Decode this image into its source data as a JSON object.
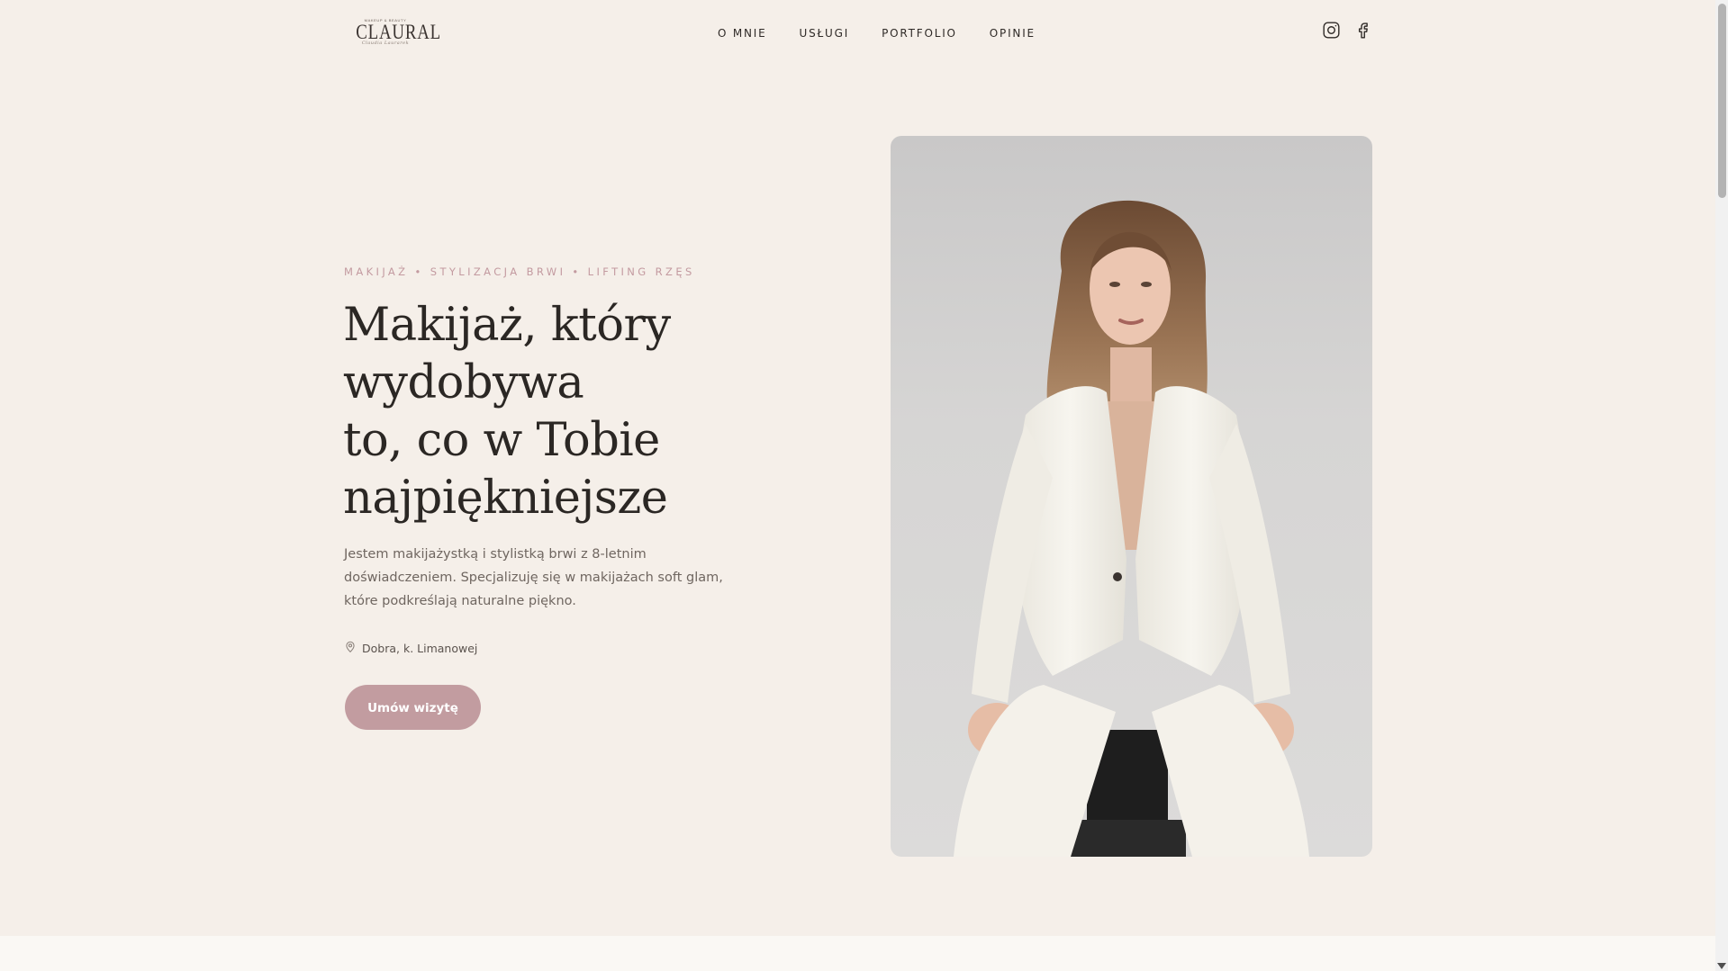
{
  "logo": {
    "top_text": "MAKEUP & BEAUTY",
    "main_text": "CLAURAL",
    "sub_text": "Claudia Laurarek"
  },
  "nav": {
    "items": [
      {
        "label": "O MNIE"
      },
      {
        "label": "USŁUGI"
      },
      {
        "label": "PORTFOLIO"
      },
      {
        "label": "OPINIE"
      }
    ]
  },
  "social": {
    "icons": [
      "instagram-icon",
      "facebook-icon"
    ]
  },
  "hero": {
    "tagline": "MAKIJAŻ • STYLIZACJA BRWI • LIFTING RZĘS",
    "headline": {
      "line1": "Makijaż, który",
      "line2": "wydobywa",
      "line3": "to, co w Tobie",
      "line4": "najpiękniejsze"
    },
    "description": "Jestem makijażystką i stylistką brwi z 8-letnim doświadczeniem. Specjalizuję się w makijażach soft glam, które podkreślają naturalne piękno.",
    "location": "Dobra, k. Limanowej",
    "cta_label": "Umów wizytę",
    "photo_alt": "Portrait of a woman in a cream suit sitting on a stool"
  },
  "colors": {
    "background": "#f5efe9",
    "accent": "#c29ca0",
    "text": "#2b2724",
    "muted": "#6f6660",
    "section_bg": "#faf8f4"
  }
}
